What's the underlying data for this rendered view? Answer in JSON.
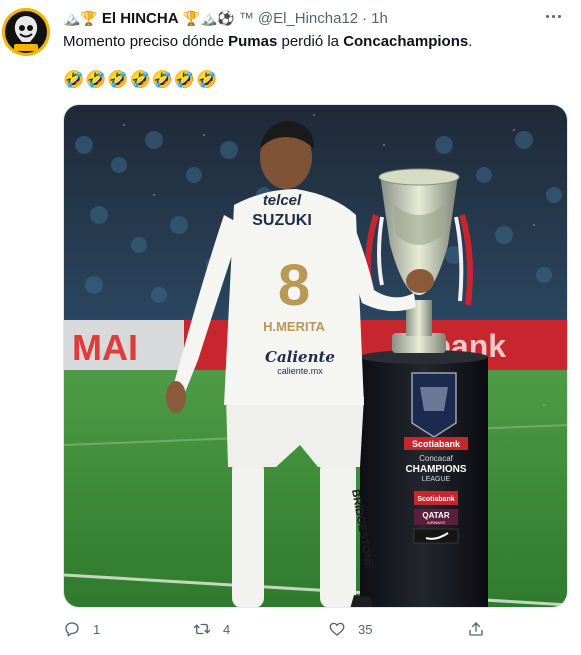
{
  "tweet": {
    "author": {
      "display_name": "El HINCHA",
      "handle": "@El_Hincha12",
      "name_emojis_before": "🏔️🏆",
      "name_emojis_after": "🏆🏔️⚽",
      "trademark": "™",
      "avatar_icon": "avatar-logo"
    },
    "separator": "·",
    "time": "1h",
    "text": {
      "part1": "Momento preciso dónde ",
      "bold1": "Pumas",
      "part2": " perdió la ",
      "bold2": "Concachampions",
      "part3": "."
    },
    "emojis": "🤣🤣🤣🤣🤣🤣🤣",
    "media": {
      "jersey_sponsor_top": "telcel",
      "jersey_sponsor_main": "SUZUKI",
      "jersey_number": "8",
      "jersey_name": "H.MERITA",
      "jersey_sponsor_lower": "Caliente",
      "jersey_sponsor_url": "caliente.mx",
      "sock_text": "BRIDGESTONE",
      "pedestal_bank": "Scotiabank",
      "pedestal_league_line1": "Concacaf",
      "pedestal_league_line2": "CHAMPIONS",
      "pedestal_league_line3": "LEAGUE",
      "pedestal_sponsor1": "Scotiabank",
      "pedestal_sponsor2": "QATAR",
      "pedestal_sponsor2_sub": "AIRWAYS",
      "board_left": "MAI",
      "board_right": "tiabank"
    },
    "actions": {
      "reply_count": "1",
      "retweet_count": "4",
      "like_count": "35"
    },
    "colors": {
      "text": "#0f1419",
      "secondary": "#536471",
      "pitch_green": "#3f8f3a",
      "board_red": "#c8262e"
    }
  }
}
